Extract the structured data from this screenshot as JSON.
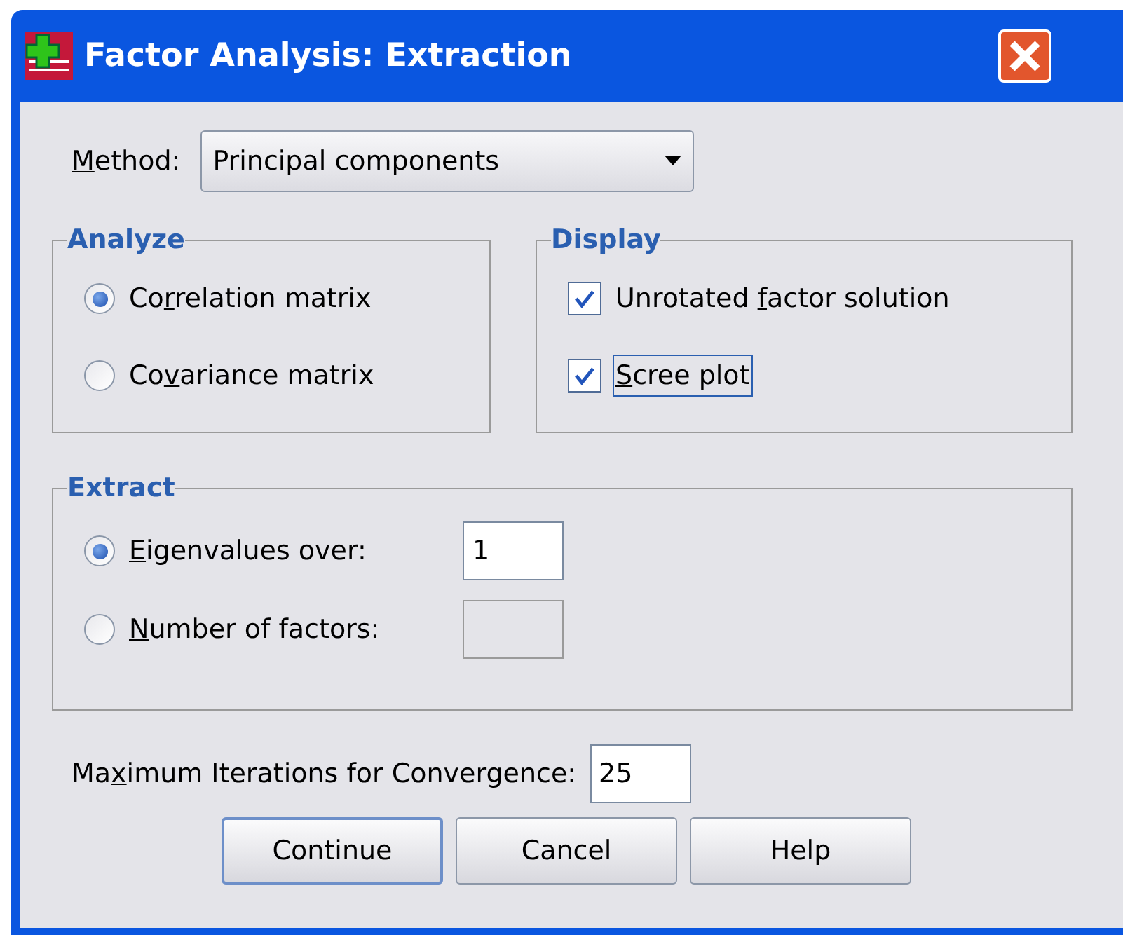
{
  "window": {
    "title": "Factor Analysis: Extraction"
  },
  "method": {
    "mnemonic": "M",
    "label_end": "ethod:",
    "value": "Principal components"
  },
  "analyze": {
    "title": "Analyze",
    "options": [
      {
        "label_start": "Co",
        "mnemonic": "r",
        "label_end": "relation matrix",
        "selected": true
      },
      {
        "label_start": "Co",
        "mnemonic": "v",
        "label_end": "ariance matrix",
        "selected": false
      }
    ]
  },
  "display": {
    "title": "Display",
    "options": [
      {
        "label_start": "Unrotated ",
        "mnemonic": "f",
        "label_end": "actor solution",
        "checked": true,
        "focused": false
      },
      {
        "mnemonic": "S",
        "label_end": "cree plot",
        "checked": true,
        "focused": true
      }
    ]
  },
  "extract": {
    "title": "Extract",
    "options": [
      {
        "mnemonic": "E",
        "label_end": "igenvalues over:",
        "selected": true,
        "value": "1",
        "disabled": false
      },
      {
        "mnemonic": "N",
        "label_end": "umber of factors:",
        "selected": false,
        "disabled": true
      }
    ]
  },
  "max_iterations": {
    "label_start": "Ma",
    "mnemonic": "x",
    "label_end": "imum Iterations for Convergence:",
    "value": "25"
  },
  "buttons": [
    {
      "label": "Continue",
      "default": true
    },
    {
      "label": "Cancel",
      "default": false
    },
    {
      "label": "Help",
      "default": false
    }
  ]
}
